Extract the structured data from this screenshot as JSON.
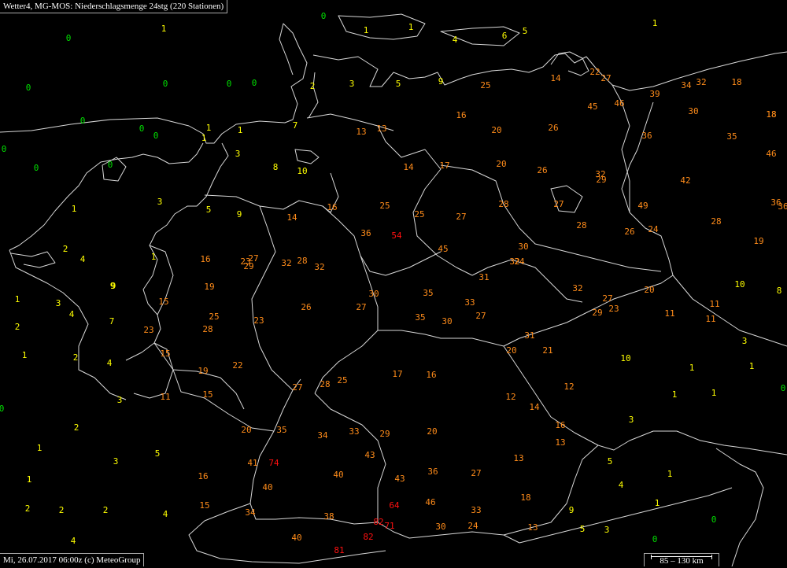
{
  "title": "Wetter4, MG-MOS: Niederschlagsmenge 24stg (220 Stationen)",
  "footer": "Mi, 26.07.2017 06:00z (c) MeteoGroup",
  "scale_label": "85 – 130 km",
  "colors": {
    "0": "#00e000",
    "1": "#ffff00",
    "2": "#ff8c1a",
    "3": "#ff1010"
  },
  "stations": [
    {
      "v": "0"
    },
    {
      "v": "1"
    },
    {
      "v": "1"
    },
    {
      "v": "1"
    },
    {
      "v": "0"
    },
    {
      "v": "0"
    },
    {
      "v": "4"
    },
    {
      "v": "6"
    },
    {
      "v": "5"
    },
    {
      "v": "1"
    },
    {
      "v": "0"
    },
    {
      "v": "0"
    },
    {
      "v": "0"
    },
    {
      "v": "2"
    },
    {
      "v": "3"
    },
    {
      "v": "5"
    },
    {
      "v": "9"
    },
    {
      "v": "0"
    },
    {
      "v": "25"
    },
    {
      "v": "14"
    },
    {
      "v": "22"
    },
    {
      "v": "27"
    },
    {
      "v": "34"
    },
    {
      "v": "32"
    },
    {
      "v": "18"
    },
    {
      "v": "0"
    },
    {
      "v": "18"
    },
    {
      "v": "39"
    },
    {
      "v": "45"
    },
    {
      "v": "46"
    },
    {
      "v": "7"
    },
    {
      "v": "0"
    },
    {
      "v": "1"
    },
    {
      "v": "0"
    },
    {
      "v": "1"
    },
    {
      "v": "13"
    },
    {
      "v": "13"
    },
    {
      "v": "16"
    },
    {
      "v": "20"
    },
    {
      "v": "26"
    },
    {
      "v": "30"
    },
    {
      "v": "18"
    },
    {
      "v": "0"
    },
    {
      "v": "1"
    },
    {
      "v": "36"
    },
    {
      "v": "35"
    },
    {
      "v": "3"
    },
    {
      "v": "0"
    },
    {
      "v": "8"
    },
    {
      "v": "10"
    },
    {
      "v": "14"
    },
    {
      "v": "17"
    },
    {
      "v": "20"
    },
    {
      "v": "26"
    },
    {
      "v": "46"
    },
    {
      "v": "32"
    },
    {
      "v": "29"
    },
    {
      "v": "42"
    },
    {
      "v": "1"
    },
    {
      "v": "3"
    },
    {
      "v": "5"
    },
    {
      "v": "9"
    },
    {
      "v": "14"
    },
    {
      "v": "16"
    },
    {
      "v": "25"
    },
    {
      "v": "25"
    },
    {
      "v": "27"
    },
    {
      "v": "28"
    },
    {
      "v": "27"
    },
    {
      "v": "49"
    },
    {
      "v": "36"
    },
    {
      "v": "36"
    },
    {
      "v": "2"
    },
    {
      "v": "4"
    },
    {
      "v": "36"
    },
    {
      "v": "54"
    },
    {
      "v": "28"
    },
    {
      "v": "26"
    },
    {
      "v": "24"
    },
    {
      "v": "28"
    },
    {
      "v": "1"
    },
    {
      "v": "9"
    },
    {
      "v": "16"
    },
    {
      "v": "23"
    },
    {
      "v": "27"
    },
    {
      "v": "29"
    },
    {
      "v": "32"
    },
    {
      "v": "28"
    },
    {
      "v": "32"
    },
    {
      "v": "45"
    },
    {
      "v": "30"
    },
    {
      "v": "32"
    },
    {
      "v": "24"
    },
    {
      "v": "19"
    },
    {
      "v": "9"
    },
    {
      "v": "19"
    },
    {
      "v": "31"
    },
    {
      "v": "1"
    },
    {
      "v": "3"
    },
    {
      "v": "15"
    },
    {
      "v": "30"
    },
    {
      "v": "35"
    },
    {
      "v": "32"
    },
    {
      "v": "27"
    },
    {
      "v": "20"
    },
    {
      "v": "10"
    },
    {
      "v": "8"
    },
    {
      "v": "4"
    },
    {
      "v": "7"
    },
    {
      "v": "25"
    },
    {
      "v": "26"
    },
    {
      "v": "27"
    },
    {
      "v": "33"
    },
    {
      "v": "11"
    },
    {
      "v": "2"
    },
    {
      "v": "23"
    },
    {
      "v": "28"
    },
    {
      "v": "23"
    },
    {
      "v": "35"
    },
    {
      "v": "30"
    },
    {
      "v": "27"
    },
    {
      "v": "29"
    },
    {
      "v": "23"
    },
    {
      "v": "11"
    },
    {
      "v": "11"
    },
    {
      "v": "31"
    },
    {
      "v": "3"
    },
    {
      "v": "1"
    },
    {
      "v": "2"
    },
    {
      "v": "15"
    },
    {
      "v": "20"
    },
    {
      "v": "21"
    },
    {
      "v": "4"
    },
    {
      "v": "19"
    },
    {
      "v": "22"
    },
    {
      "v": "17"
    },
    {
      "v": "16"
    },
    {
      "v": "10"
    },
    {
      "v": "1"
    },
    {
      "v": "1"
    },
    {
      "v": "27"
    },
    {
      "v": "28"
    },
    {
      "v": "25"
    },
    {
      "v": "12"
    },
    {
      "v": "12"
    },
    {
      "v": "0"
    },
    {
      "v": "3"
    },
    {
      "v": "11"
    },
    {
      "v": "15"
    },
    {
      "v": "1"
    },
    {
      "v": "1"
    },
    {
      "v": "14"
    },
    {
      "v": "0"
    },
    {
      "v": "2"
    },
    {
      "v": "20"
    },
    {
      "v": "35"
    },
    {
      "v": "34"
    },
    {
      "v": "33"
    },
    {
      "v": "29"
    },
    {
      "v": "20"
    },
    {
      "v": "16"
    },
    {
      "v": "3"
    },
    {
      "v": "1"
    },
    {
      "v": "5"
    },
    {
      "v": "43"
    },
    {
      "v": "13"
    },
    {
      "v": "13"
    },
    {
      "v": "3"
    },
    {
      "v": "41"
    },
    {
      "v": "74"
    },
    {
      "v": "5"
    },
    {
      "v": "1"
    },
    {
      "v": "16"
    },
    {
      "v": "40"
    },
    {
      "v": "36"
    },
    {
      "v": "43"
    },
    {
      "v": "27"
    },
    {
      "v": "4"
    },
    {
      "v": "1"
    },
    {
      "v": "40"
    },
    {
      "v": "18"
    },
    {
      "v": "2"
    },
    {
      "v": "2"
    },
    {
      "v": "2"
    },
    {
      "v": "15"
    },
    {
      "v": "64"
    },
    {
      "v": "46"
    },
    {
      "v": "1"
    },
    {
      "v": "4"
    },
    {
      "v": "34"
    },
    {
      "v": "33"
    },
    {
      "v": "9"
    },
    {
      "v": "38"
    },
    {
      "v": "82"
    },
    {
      "v": "71"
    },
    {
      "v": "30"
    },
    {
      "v": "24"
    },
    {
      "v": "13"
    },
    {
      "v": "5"
    },
    {
      "v": "3"
    },
    {
      "v": "0"
    },
    {
      "v": "4"
    },
    {
      "v": "40"
    },
    {
      "v": "82"
    },
    {
      "v": "0"
    },
    {
      "v": "81"
    }
  ]
}
